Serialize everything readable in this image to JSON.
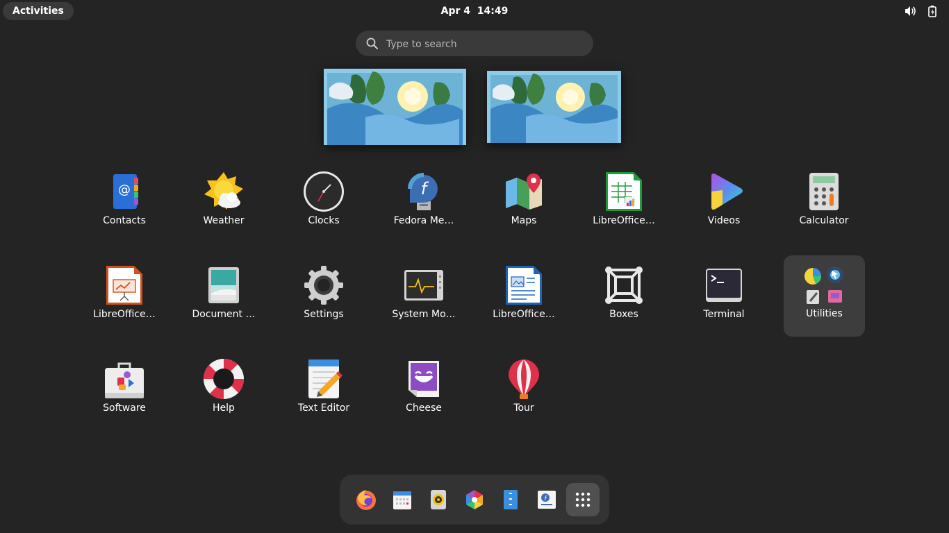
{
  "topbar": {
    "activities_label": "Activities",
    "date": "Apr 4",
    "time": "14:49",
    "tray_icons": [
      "volume-icon",
      "battery-icon"
    ]
  },
  "search": {
    "placeholder": "Type to search",
    "icon": "search-icon"
  },
  "workspaces": [
    {
      "name": "workspace-1"
    },
    {
      "name": "workspace-2"
    }
  ],
  "app_grid": {
    "rows": [
      [
        {
          "label": "Contacts",
          "icon": "contacts-icon"
        },
        {
          "label": "Weather",
          "icon": "weather-icon"
        },
        {
          "label": "Clocks",
          "icon": "clocks-icon"
        },
        {
          "label": "Fedora Me…",
          "icon": "fedora-media-writer-icon"
        },
        {
          "label": "Maps",
          "icon": "maps-icon"
        },
        {
          "label": "LibreOffice…",
          "icon": "libreoffice-calc-icon"
        },
        {
          "label": "Videos",
          "icon": "videos-icon"
        },
        {
          "label": "Calculator",
          "icon": "calculator-icon"
        }
      ],
      [
        {
          "label": "LibreOffice…",
          "icon": "libreoffice-impress-icon"
        },
        {
          "label": "Document …",
          "icon": "document-scanner-icon"
        },
        {
          "label": "Settings",
          "icon": "settings-gear-icon"
        },
        {
          "label": "System Mo…",
          "icon": "system-monitor-icon"
        },
        {
          "label": "LibreOffice…",
          "icon": "libreoffice-writer-icon"
        },
        {
          "label": "Boxes",
          "icon": "boxes-icon"
        },
        {
          "label": "Terminal",
          "icon": "terminal-icon"
        },
        {
          "label": "Utilities",
          "icon": "utilities-folder-icon"
        }
      ],
      [
        {
          "label": "Software",
          "icon": "software-icon"
        },
        {
          "label": "Help",
          "icon": "help-lifebuoy-icon"
        },
        {
          "label": "Text Editor",
          "icon": "text-editor-icon"
        },
        {
          "label": "Cheese",
          "icon": "cheese-icon"
        },
        {
          "label": "Tour",
          "icon": "tour-balloon-icon"
        }
      ]
    ]
  },
  "dock": {
    "items": [
      {
        "icon": "firefox-icon"
      },
      {
        "icon": "calendar-icon"
      },
      {
        "icon": "rhythmbox-icon"
      },
      {
        "icon": "photos-icon"
      },
      {
        "icon": "files-icon"
      },
      {
        "icon": "fedora-docs-icon"
      },
      {
        "icon": "show-apps-grid-icon"
      }
    ]
  },
  "colors": {
    "background": "#242424",
    "panel": "#3a3a3a",
    "dock": "#333333",
    "folder_highlight": "#3d3d3d"
  }
}
